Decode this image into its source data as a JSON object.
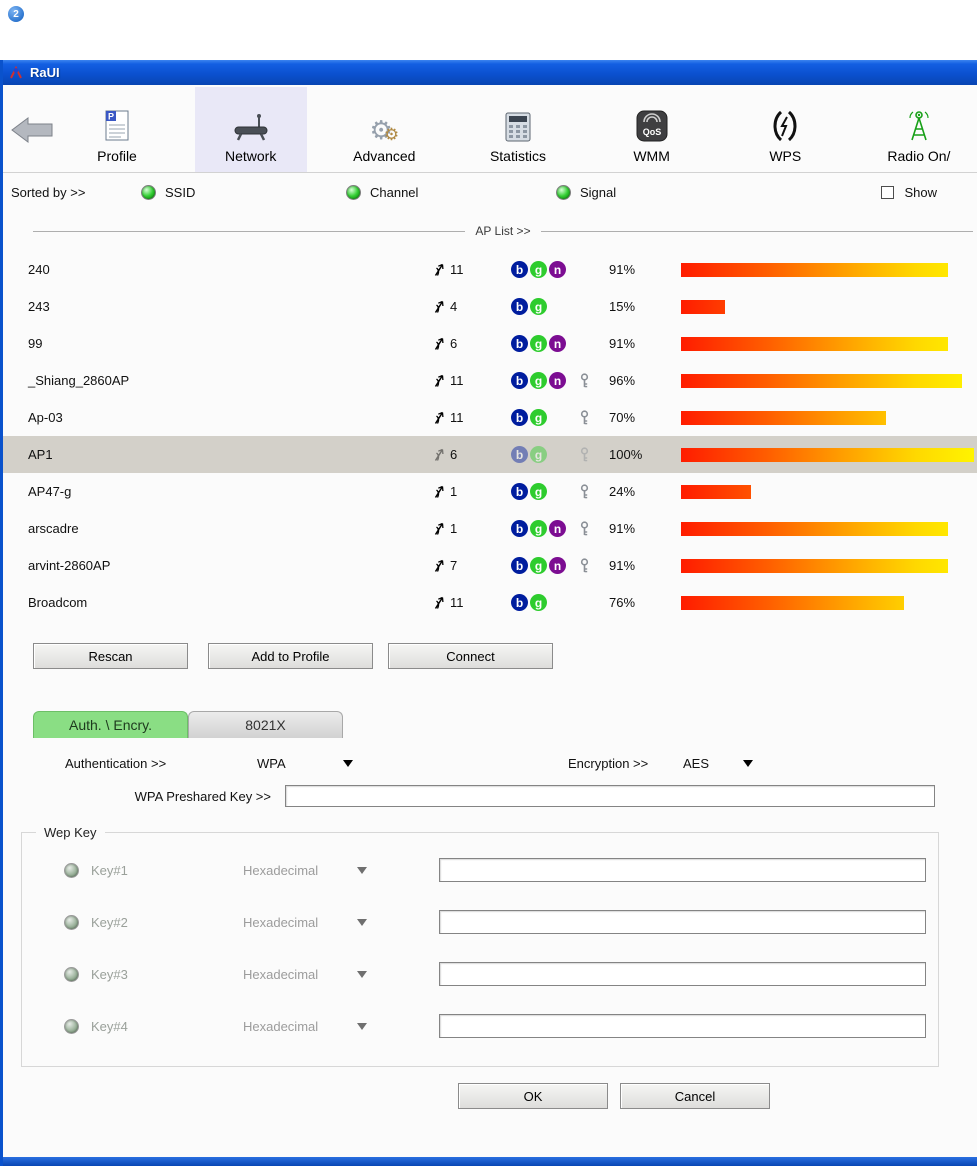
{
  "page": {
    "step_badge": "2"
  },
  "colors": {
    "titlebar_blue": "#0b51d0",
    "active_tab_green": "#8ade84",
    "selected_row_gray": "#d3d0c9",
    "toolbar_active_bg": "#e9e8f7",
    "signal_bar_start": "#ff1c00",
    "signal_bar_end": "#fff400",
    "mode_b_navy": "#001d9e",
    "mode_g_green": "#2ecc2e",
    "mode_n_purple": "#7c0d92"
  },
  "window": {
    "title": "RaUI",
    "toolbar": {
      "back_icon": "back-arrow-icon",
      "items": [
        {
          "label": "Profile",
          "icon": "profile-icon",
          "active": false
        },
        {
          "label": "Network",
          "icon": "network-icon",
          "active": true
        },
        {
          "label": "Advanced",
          "icon": "gears-icon",
          "active": false
        },
        {
          "label": "Statistics",
          "icon": "calculator-icon",
          "active": false
        },
        {
          "label": "WMM",
          "icon": "qos-icon",
          "active": false
        },
        {
          "label": "WPS",
          "icon": "wps-icon",
          "active": false
        },
        {
          "label": "Radio On/",
          "icon": "radio-tower-icon",
          "active": false
        }
      ]
    },
    "sort_bar": {
      "label": "Sorted by >>",
      "options": [
        {
          "label": "SSID"
        },
        {
          "label": "Channel"
        },
        {
          "label": "Signal"
        }
      ],
      "show_checkbox_label": "Show",
      "show_checkbox_checked": false
    },
    "ap_list": {
      "header": "AP List >>",
      "rows": [
        {
          "ssid": "240",
          "channel": 11,
          "modes": [
            "b",
            "g",
            "n"
          ],
          "lock": false,
          "signal": "91%",
          "pct": 91,
          "selected": false
        },
        {
          "ssid": "243",
          "channel": 4,
          "modes": [
            "b",
            "g"
          ],
          "lock": false,
          "signal": "15%",
          "pct": 15,
          "selected": false
        },
        {
          "ssid": "99",
          "channel": 6,
          "modes": [
            "b",
            "g",
            "n"
          ],
          "lock": false,
          "signal": "91%",
          "pct": 91,
          "selected": false
        },
        {
          "ssid": "_Shiang_2860AP",
          "channel": 11,
          "modes": [
            "b",
            "g",
            "n"
          ],
          "lock": true,
          "signal": "96%",
          "pct": 96,
          "selected": false
        },
        {
          "ssid": "Ap-03",
          "channel": 11,
          "modes": [
            "b",
            "g"
          ],
          "lock": true,
          "signal": "70%",
          "pct": 70,
          "selected": false
        },
        {
          "ssid": "AP1",
          "channel": 6,
          "modes": [
            "b",
            "g"
          ],
          "lock": true,
          "signal": "100%",
          "pct": 100,
          "selected": true
        },
        {
          "ssid": "AP47-g",
          "channel": 1,
          "modes": [
            "b",
            "g"
          ],
          "lock": true,
          "signal": "24%",
          "pct": 24,
          "selected": false
        },
        {
          "ssid": "arscadre",
          "channel": 1,
          "modes": [
            "b",
            "g",
            "n"
          ],
          "lock": true,
          "signal": "91%",
          "pct": 91,
          "selected": false
        },
        {
          "ssid": "arvint-2860AP",
          "channel": 7,
          "modes": [
            "b",
            "g",
            "n"
          ],
          "lock": true,
          "signal": "91%",
          "pct": 91,
          "selected": false
        },
        {
          "ssid": "Broadcom",
          "channel": 11,
          "modes": [
            "b",
            "g"
          ],
          "lock": false,
          "signal": "76%",
          "pct": 76,
          "selected": false
        }
      ],
      "buttons": [
        {
          "label": "Rescan"
        },
        {
          "label": "Add to Profile"
        },
        {
          "label": "Connect"
        }
      ]
    },
    "auth_panel": {
      "tabs": [
        {
          "label": "Auth. \\ Encry.",
          "active": true
        },
        {
          "label": "8021X",
          "active": false
        }
      ],
      "authentication": {
        "label": "Authentication >>",
        "value": "WPA"
      },
      "encryption": {
        "label": "Encryption >>",
        "value": "AES"
      },
      "preshared_key": {
        "label": "WPA Preshared Key >>",
        "value": ""
      },
      "wep_key_group": {
        "label": "Wep Key",
        "rows": [
          {
            "key_label": "Key#1",
            "format": "Hexadecimal",
            "value": ""
          },
          {
            "key_label": "Key#2",
            "format": "Hexadecimal",
            "value": ""
          },
          {
            "key_label": "Key#3",
            "format": "Hexadecimal",
            "value": ""
          },
          {
            "key_label": "Key#4",
            "format": "Hexadecimal",
            "value": ""
          }
        ]
      },
      "ok_label": "OK",
      "cancel_label": "Cancel"
    }
  }
}
